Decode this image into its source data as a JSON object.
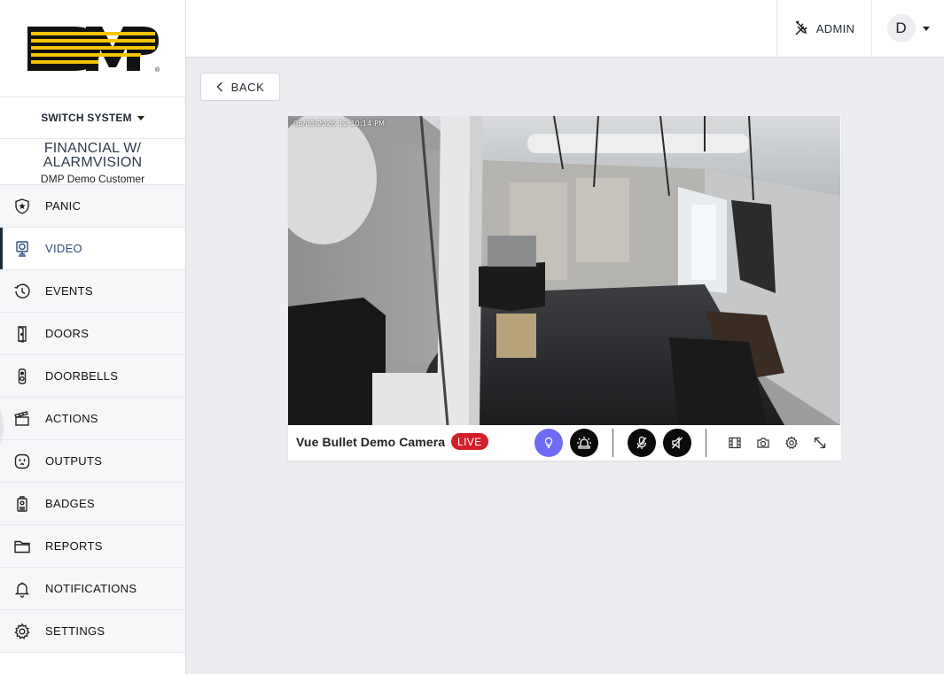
{
  "brand": {
    "logo_text": "DMP"
  },
  "sidebar": {
    "switch_system_label": "SWITCH SYSTEM",
    "system_name": "FINANCIAL W/ ALARMVISION",
    "customer_name": "DMP Demo Customer",
    "items": [
      {
        "label": "PANIC",
        "icon": "shield-star-icon"
      },
      {
        "label": "VIDEO",
        "icon": "camera-icon",
        "active": true
      },
      {
        "label": "EVENTS",
        "icon": "history-icon"
      },
      {
        "label": "DOORS",
        "icon": "door-icon"
      },
      {
        "label": "DOORBELLS",
        "icon": "doorbell-icon"
      },
      {
        "label": "ACTIONS",
        "icon": "clapperboard-icon"
      },
      {
        "label": "OUTPUTS",
        "icon": "outlet-icon"
      },
      {
        "label": "BADGES",
        "icon": "badge-icon"
      },
      {
        "label": "REPORTS",
        "icon": "folder-icon"
      },
      {
        "label": "NOTIFICATIONS",
        "icon": "bell-icon"
      },
      {
        "label": "SETTINGS",
        "icon": "gear-icon"
      }
    ]
  },
  "header": {
    "admin_label": "ADMIN",
    "user_initial": "D"
  },
  "back_label": "BACK",
  "camera": {
    "name": "Vue Bullet Demo Camera",
    "live_label": "LIVE",
    "timestamp": "06/03/2026 12:10:14 PM",
    "controls": [
      "light-icon",
      "siren-icon",
      "mic-off-icon",
      "speaker-off-icon",
      "clip-icon",
      "snapshot-icon",
      "settings-icon",
      "expand-icon"
    ]
  },
  "colors": {
    "accent": "#6d6cf3",
    "live": "#d21f2a",
    "brand_yellow": "#f5c400",
    "active_nav": "#1e2b3c"
  }
}
